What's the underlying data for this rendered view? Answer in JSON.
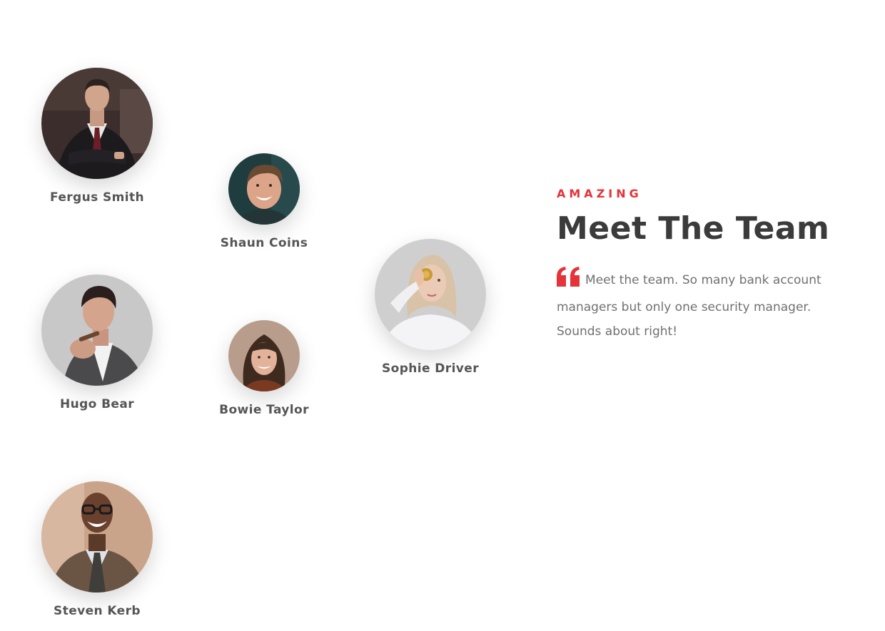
{
  "team": [
    {
      "id": "fergus",
      "name": "Fergus Smith"
    },
    {
      "id": "shaun",
      "name": "Shaun Coins"
    },
    {
      "id": "hugo",
      "name": "Hugo Bear"
    },
    {
      "id": "bowie",
      "name": "Bowie Taylor"
    },
    {
      "id": "sophie",
      "name": "Sophie Driver"
    },
    {
      "id": "steven",
      "name": "Steven Kerb"
    }
  ],
  "intro": {
    "eyebrow": "AMAZING",
    "title": "Meet The Team",
    "quote_icon": "quote-icon",
    "text": "Meet the team. So many bank account managers but only one security manager. Sounds about right!"
  },
  "colors": {
    "accent": "#e5333a",
    "heading": "#3b3b3b",
    "body_text": "#707070",
    "name_text": "#555555"
  }
}
